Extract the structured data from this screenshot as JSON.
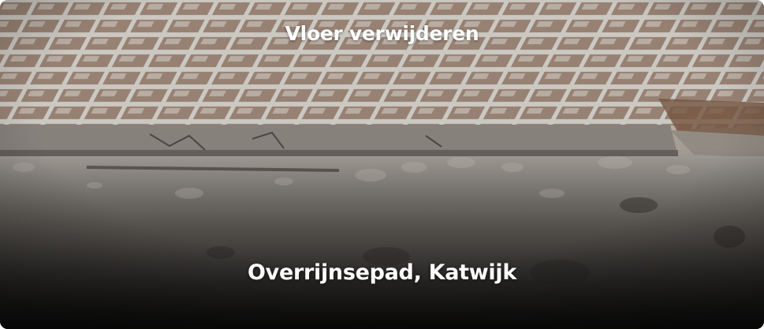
{
  "card": {
    "title": "Vloer verwijderen",
    "location": "Overrijnsepad, Katwijk",
    "image_subject": "photo-demolished-tile-floor"
  },
  "colors": {
    "text": "#ffffff",
    "tile_grout": "#d9d5cf",
    "tile_brown": "#6e4a33",
    "rubble": "#8f8a82",
    "shadow": "#1c1b1a"
  }
}
